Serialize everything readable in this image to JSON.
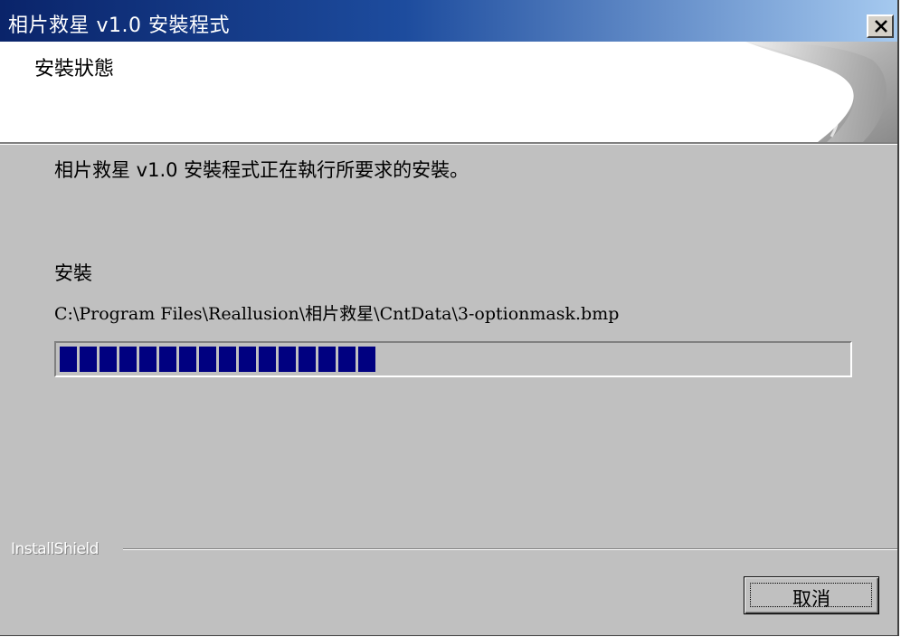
{
  "window": {
    "title": "相片救星 v1.0 安裝程式",
    "close_icon": "close-icon"
  },
  "header": {
    "title": "安裝狀態",
    "art_icon": "page-curl-graphic"
  },
  "body": {
    "status_line": "相片救星 v1.0 安裝程式正在執行所要求的安裝。",
    "action_label": "安裝",
    "current_file": "C:\\Program Files\\Reallusion\\相片救星\\CntData\\3-optionmask.bmp",
    "progress_fraction": 0.41,
    "progress_color": "#000080"
  },
  "footer": {
    "brand": "InstallShield",
    "cancel_label": "取消"
  }
}
